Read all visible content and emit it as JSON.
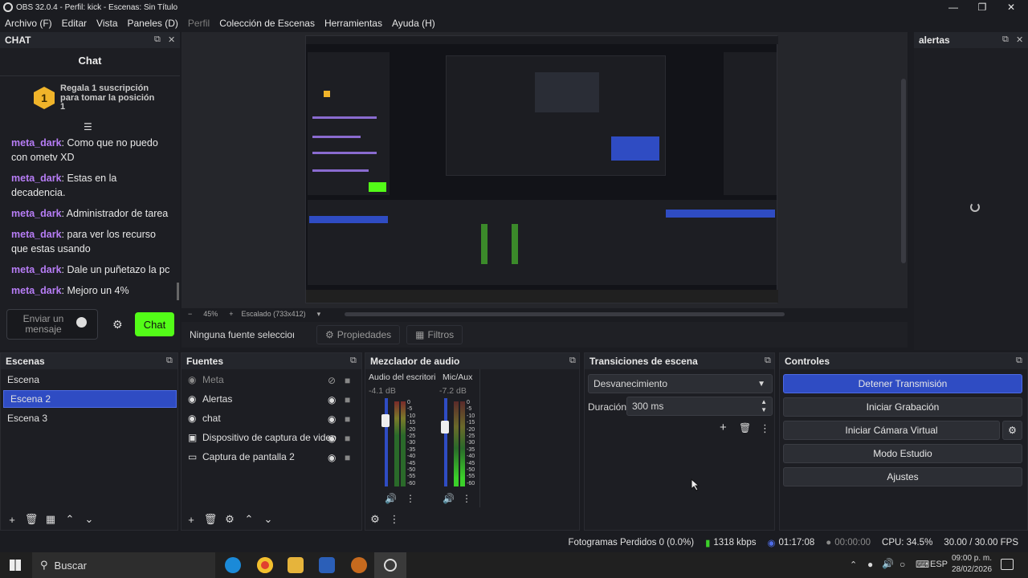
{
  "window": {
    "title": "OBS 32.0.4 - Perfil: kick - Escenas: Sin Título"
  },
  "menu": [
    "Archivo (F)",
    "Editar",
    "Vista",
    "Paneles (D)",
    "Perfil",
    "Colección de Escenas",
    "Herramientas",
    "Ayuda (H)"
  ],
  "chat": {
    "dock_title": "CHAT",
    "header": "Chat",
    "promo_badge": "1",
    "promo_text": "Regala 1 suscripción para tomar la posición 1",
    "messages": [
      {
        "user": "meta_dark",
        "text": ": Como que no puedo con ometv XD"
      },
      {
        "user": "meta_dark",
        "text": ": Estas en la decadencia."
      },
      {
        "user": "meta_dark",
        "text": ": Administrador de tarea"
      },
      {
        "user": "meta_dark",
        "text": ": para ver los recurso que estas usando"
      },
      {
        "user": "meta_dark",
        "text": ": Dale un puñetazo la pc"
      },
      {
        "user": "meta_dark",
        "text": ": Mejoro un 4%"
      }
    ],
    "input_placeholder": "Enviar un mensaje",
    "send_label": "Chat"
  },
  "alerts": {
    "dock_title": "alertas"
  },
  "zoom": {
    "level": "45%",
    "scaling": "Escalado (733x412)"
  },
  "source_bar": {
    "status": "Ninguna fuente seleccionada",
    "properties": "Propiedades",
    "filters": "Filtros"
  },
  "scenes": {
    "title": "Escenas",
    "items": [
      "Escena",
      "Escena 2",
      "Escena 3"
    ],
    "selected": "Escena 2"
  },
  "sources": {
    "title": "Fuentes",
    "items": [
      "Meta",
      "Alertas",
      "chat",
      "Dispositivo de captura de video",
      "Captura de pantalla 2"
    ]
  },
  "mixer": {
    "title": "Mezclador de audio",
    "channels": [
      {
        "name": "Audio del escritorio",
        "db": "-4.1 dB"
      },
      {
        "name": "Mic/Aux",
        "db": "-7.2 dB"
      }
    ],
    "scale": [
      "0",
      "-5",
      "-10",
      "-15",
      "-20",
      "-25",
      "-30",
      "-35",
      "-40",
      "-45",
      "-50",
      "-55",
      "-60"
    ]
  },
  "transitions": {
    "title": "Transiciones de escena",
    "selected": "Desvanecimiento",
    "duration_label": "Duración",
    "duration_value": "300 ms"
  },
  "controls": {
    "title": "Controles",
    "stop_stream": "Detener Transmisión",
    "start_recording": "Iniciar Grabación",
    "virtual_cam": "Iniciar Cámara Virtual",
    "studio_mode": "Modo Estudio",
    "settings": "Ajustes"
  },
  "status": {
    "dropped": "Fotogramas Perdidos 0 (0.0%)",
    "bitrate": "1318 kbps",
    "stream_time": "01:17:08",
    "rec_time": "00:00:00",
    "cpu": "CPU: 34.5%",
    "fps": "30.00 / 30.00 FPS"
  },
  "taskbar": {
    "search": "Buscar",
    "lang": "ESP",
    "time": "09:00 p. m.",
    "date": "28/02/2026"
  },
  "colors": {
    "accent": "#2f4cc3",
    "chat_user": "#b77df6",
    "chat_button": "#53fc18"
  }
}
